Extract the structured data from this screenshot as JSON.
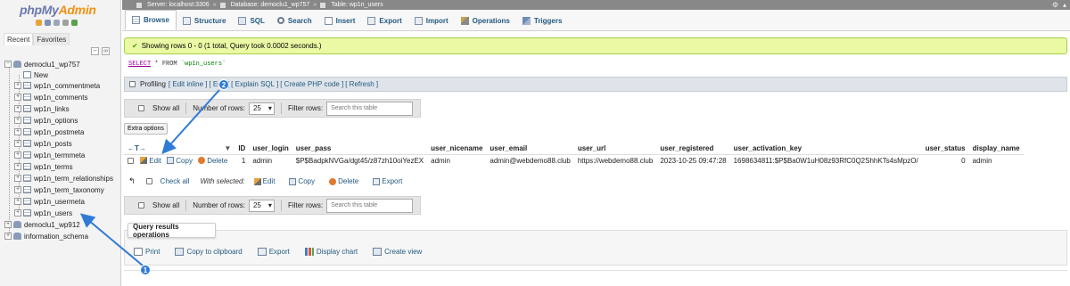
{
  "app": {
    "logo_php": "php",
    "logo_my": "My",
    "logo_admin": "Admin"
  },
  "nav": {
    "tabs": [
      "Recent",
      "Favorites"
    ],
    "databases": [
      {
        "name": "democlu1_wp757",
        "new_label": "New",
        "tables": [
          "wp1n_commentmeta",
          "wp1n_comments",
          "wp1n_links",
          "wp1n_options",
          "wp1n_postmeta",
          "wp1n_posts",
          "wp1n_termmeta",
          "wp1n_terms",
          "wp1n_term_relationships",
          "wp1n_term_taxonomy",
          "wp1n_usermeta",
          "wp1n_users"
        ]
      },
      {
        "name": "democlu1_wp912"
      },
      {
        "name": "information_schema"
      }
    ]
  },
  "breadcrumb": {
    "server": "Server: localhost:3306",
    "database": "Database: democlu1_wp757",
    "table": "Table: wp1n_users"
  },
  "tabs": [
    "Browse",
    "Structure",
    "SQL",
    "Search",
    "Insert",
    "Export",
    "Import",
    "Operations",
    "Triggers"
  ],
  "message": "Showing rows 0 - 0 (1 total, Query took 0.0002 seconds.)",
  "query": {
    "select": "SELECT",
    "rest": " * FROM ",
    "table": "`wp1n_users`"
  },
  "profiling": {
    "label": "Profiling",
    "links": [
      "[ Edit inline ]",
      "[ Edit ]",
      "[ Explain SQL ]",
      "[ Create PHP code ]",
      "[ Refresh ]"
    ]
  },
  "navbar": {
    "show_all": "Show all",
    "rows_label": "Number of rows:",
    "rows_value": "25",
    "filter_label": "Filter rows:",
    "filter_placeholder": "Search this table"
  },
  "extra_options": "Extra options",
  "table": {
    "columns": [
      "ID",
      "user_login",
      "user_pass",
      "user_nicename",
      "user_email",
      "user_url",
      "user_registered",
      "user_activation_key",
      "user_status",
      "display_name"
    ],
    "row_actions": {
      "edit": "Edit",
      "copy": "Copy",
      "delete": "Delete"
    },
    "rows": [
      [
        "1",
        "admin",
        "$P$BadpkNVGa/dgt45/z87zh10oiYezEX",
        "admin",
        "admin@webdemo88.club",
        "https://webdemo88.club",
        "2023-10-25 09:47:28",
        "1698634811:$P$Ba0W1uH08z93RfC0Q2ShhKTs4sMpzO/",
        "0",
        "admin"
      ]
    ]
  },
  "with_selected": {
    "check_all": "Check all",
    "label": "With selected:",
    "edit": "Edit",
    "copy": "Copy",
    "delete": "Delete",
    "export": "Export"
  },
  "query_ops": {
    "title": "Query results operations",
    "actions": [
      "Print",
      "Copy to clipboard",
      "Export",
      "Display chart",
      "Create view"
    ]
  },
  "annotations": [
    "1",
    "2"
  ],
  "colors": {
    "link": "#235a81",
    "success_bg": "#ebf8a4",
    "annotation": "#2f7bd6"
  }
}
